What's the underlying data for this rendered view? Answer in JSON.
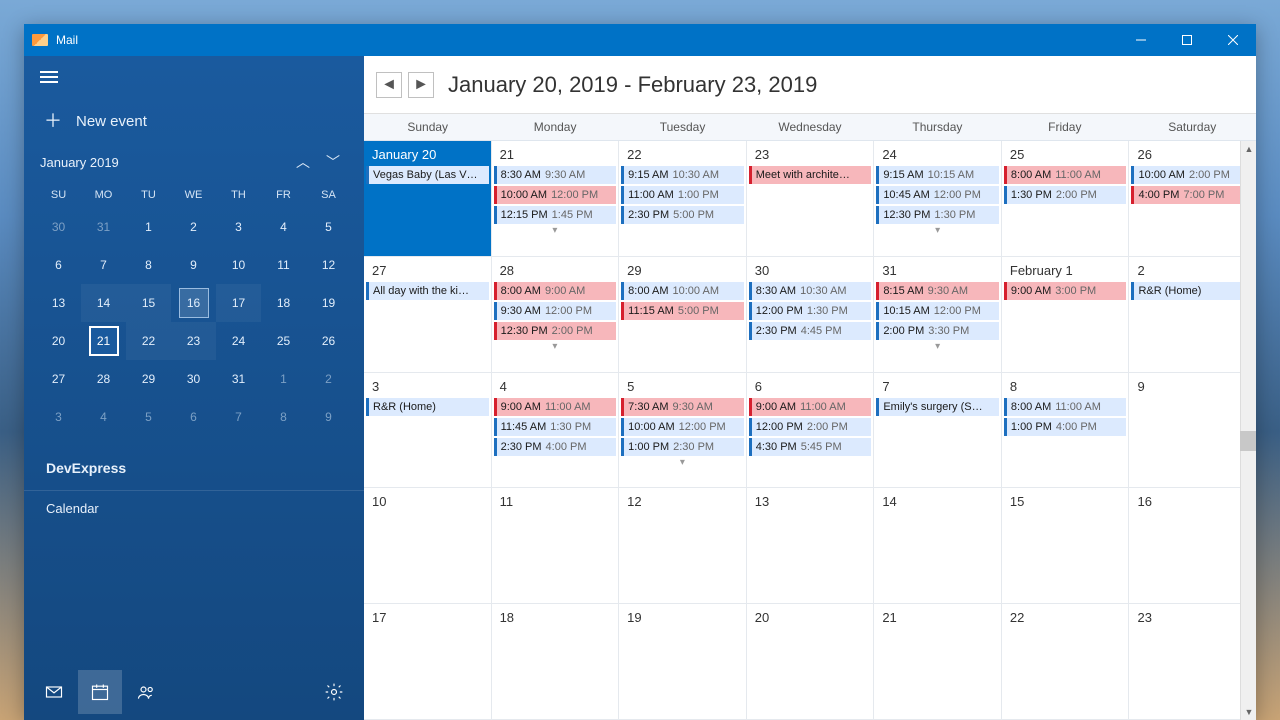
{
  "titlebar": {
    "app_name": "Mail"
  },
  "sidebar": {
    "new_event": "New event",
    "minical_label": "January 2019",
    "dow": [
      "SU",
      "MO",
      "TU",
      "WE",
      "TH",
      "FR",
      "SA"
    ],
    "weeks": [
      [
        {
          "n": "30",
          "dim": true
        },
        {
          "n": "31",
          "dim": true
        },
        {
          "n": "1"
        },
        {
          "n": "2"
        },
        {
          "n": "3"
        },
        {
          "n": "4"
        },
        {
          "n": "5"
        }
      ],
      [
        {
          "n": "6"
        },
        {
          "n": "7"
        },
        {
          "n": "8"
        },
        {
          "n": "9"
        },
        {
          "n": "10"
        },
        {
          "n": "11"
        },
        {
          "n": "12"
        }
      ],
      [
        {
          "n": "13"
        },
        {
          "n": "14",
          "hl": true
        },
        {
          "n": "15",
          "hl": true
        },
        {
          "n": "16",
          "sel": true
        },
        {
          "n": "17",
          "hl": true
        },
        {
          "n": "18"
        },
        {
          "n": "19"
        }
      ],
      [
        {
          "n": "20"
        },
        {
          "n": "21",
          "today": true
        },
        {
          "n": "22",
          "hl": true
        },
        {
          "n": "23",
          "hl": true
        },
        {
          "n": "24"
        },
        {
          "n": "25"
        },
        {
          "n": "26"
        }
      ],
      [
        {
          "n": "27"
        },
        {
          "n": "28"
        },
        {
          "n": "29"
        },
        {
          "n": "30"
        },
        {
          "n": "31"
        },
        {
          "n": "1",
          "dim": true
        },
        {
          "n": "2",
          "dim": true
        }
      ],
      [
        {
          "n": "3",
          "dim": true
        },
        {
          "n": "4",
          "dim": true
        },
        {
          "n": "5",
          "dim": true
        },
        {
          "n": "6",
          "dim": true
        },
        {
          "n": "7",
          "dim": true
        },
        {
          "n": "8",
          "dim": true
        },
        {
          "n": "9",
          "dim": true
        }
      ]
    ],
    "section": "DevExpress",
    "calendar_item": "Calendar"
  },
  "main": {
    "range_title": "January 20, 2019 - February 23, 2019",
    "day_headers": [
      "Sunday",
      "Monday",
      "Tuesday",
      "Wednesday",
      "Thursday",
      "Friday",
      "Saturday"
    ],
    "weeks": [
      [
        {
          "label": "January 20",
          "selected": true,
          "events": [
            {
              "c": "blue",
              "t": "Vegas Baby (Las V…"
            }
          ]
        },
        {
          "label": "21",
          "events": [
            {
              "c": "blue",
              "t": "8:30 AM",
              "t2": "9:30 AM"
            },
            {
              "c": "red",
              "t": "10:00 AM",
              "t2": "12:00 PM"
            },
            {
              "c": "blue",
              "t": "12:15 PM",
              "t2": "1:45 PM"
            }
          ],
          "more": true
        },
        {
          "label": "22",
          "events": [
            {
              "c": "blue",
              "t": "9:15 AM",
              "t2": "10:30 AM"
            },
            {
              "c": "blue",
              "t": "11:00 AM",
              "t2": "1:00 PM"
            },
            {
              "c": "blue",
              "t": "2:30 PM",
              "t2": "5:00 PM"
            }
          ]
        },
        {
          "label": "23",
          "events": [
            {
              "c": "red",
              "t": "Meet with archite…"
            }
          ]
        },
        {
          "label": "24",
          "events": [
            {
              "c": "blue",
              "t": "9:15 AM",
              "t2": "10:15 AM"
            },
            {
              "c": "blue",
              "t": "10:45 AM",
              "t2": "12:00 PM"
            },
            {
              "c": "blue",
              "t": "12:30 PM",
              "t2": "1:30 PM"
            }
          ],
          "more": true
        },
        {
          "label": "25",
          "events": [
            {
              "c": "red",
              "t": "8:00 AM",
              "t2": "11:00 AM"
            },
            {
              "c": "blue",
              "t": "1:30 PM",
              "t2": "2:00 PM"
            }
          ]
        },
        {
          "label": "26",
          "events": [
            {
              "c": "blue",
              "t": "10:00 AM",
              "t2": "2:00 PM"
            },
            {
              "c": "red",
              "t": "4:00 PM",
              "t2": "7:00 PM"
            }
          ]
        }
      ],
      [
        {
          "label": "27",
          "events": [
            {
              "c": "blue",
              "t": "All day with the ki…"
            }
          ]
        },
        {
          "label": "28",
          "events": [
            {
              "c": "red",
              "t": "8:00 AM",
              "t2": "9:00 AM"
            },
            {
              "c": "blue",
              "t": "9:30 AM",
              "t2": "12:00 PM"
            },
            {
              "c": "red",
              "t": "12:30 PM",
              "t2": "2:00 PM"
            }
          ],
          "more": true
        },
        {
          "label": "29",
          "events": [
            {
              "c": "blue",
              "t": "8:00 AM",
              "t2": "10:00 AM"
            },
            {
              "c": "red",
              "t": "11:15 AM",
              "t2": "5:00 PM"
            }
          ]
        },
        {
          "label": "30",
          "events": [
            {
              "c": "blue",
              "t": "8:30 AM",
              "t2": "10:30 AM"
            },
            {
              "c": "blue",
              "t": "12:00 PM",
              "t2": "1:30 PM"
            },
            {
              "c": "blue",
              "t": "2:30 PM",
              "t2": "4:45 PM"
            }
          ]
        },
        {
          "label": "31",
          "events": [
            {
              "c": "red",
              "t": "8:15 AM",
              "t2": "9:30 AM"
            },
            {
              "c": "blue",
              "t": "10:15 AM",
              "t2": "12:00 PM"
            },
            {
              "c": "blue",
              "t": "2:00 PM",
              "t2": "3:30 PM"
            }
          ],
          "more": true
        },
        {
          "label": "February 1",
          "events": [
            {
              "c": "red",
              "t": "9:00 AM",
              "t2": "3:00 PM"
            }
          ]
        },
        {
          "label": "2",
          "events": [
            {
              "c": "blue",
              "t": "R&R (Home)"
            }
          ]
        }
      ],
      [
        {
          "label": "3",
          "events": [
            {
              "c": "blue",
              "t": "R&R (Home)"
            }
          ]
        },
        {
          "label": "4",
          "events": [
            {
              "c": "red",
              "t": "9:00 AM",
              "t2": "11:00 AM"
            },
            {
              "c": "blue",
              "t": "11:45 AM",
              "t2": "1:30 PM"
            },
            {
              "c": "blue",
              "t": "2:30 PM",
              "t2": "4:00 PM"
            }
          ]
        },
        {
          "label": "5",
          "events": [
            {
              "c": "red",
              "t": "7:30 AM",
              "t2": "9:30 AM"
            },
            {
              "c": "blue",
              "t": "10:00 AM",
              "t2": "12:00 PM"
            },
            {
              "c": "blue",
              "t": "1:00 PM",
              "t2": "2:30 PM"
            }
          ],
          "more": true
        },
        {
          "label": "6",
          "events": [
            {
              "c": "red",
              "t": "9:00 AM",
              "t2": "11:00 AM"
            },
            {
              "c": "blue",
              "t": "12:00 PM",
              "t2": "2:00 PM"
            },
            {
              "c": "blue",
              "t": "4:30 PM",
              "t2": "5:45 PM"
            }
          ]
        },
        {
          "label": "7",
          "events": [
            {
              "c": "blue",
              "t": "Emily's surgery (S…"
            }
          ]
        },
        {
          "label": "8",
          "events": [
            {
              "c": "blue",
              "t": "8:00 AM",
              "t2": "11:00 AM"
            },
            {
              "c": "blue",
              "t": "1:00 PM",
              "t2": "4:00 PM"
            }
          ]
        },
        {
          "label": "9",
          "events": []
        }
      ],
      [
        {
          "label": "10",
          "events": []
        },
        {
          "label": "11",
          "events": []
        },
        {
          "label": "12",
          "events": []
        },
        {
          "label": "13",
          "events": []
        },
        {
          "label": "14",
          "events": []
        },
        {
          "label": "15",
          "events": []
        },
        {
          "label": "16",
          "events": []
        }
      ],
      [
        {
          "label": "17",
          "events": []
        },
        {
          "label": "18",
          "events": []
        },
        {
          "label": "19",
          "events": []
        },
        {
          "label": "20",
          "events": []
        },
        {
          "label": "21",
          "events": []
        },
        {
          "label": "22",
          "events": []
        },
        {
          "label": "23",
          "events": []
        }
      ]
    ]
  }
}
